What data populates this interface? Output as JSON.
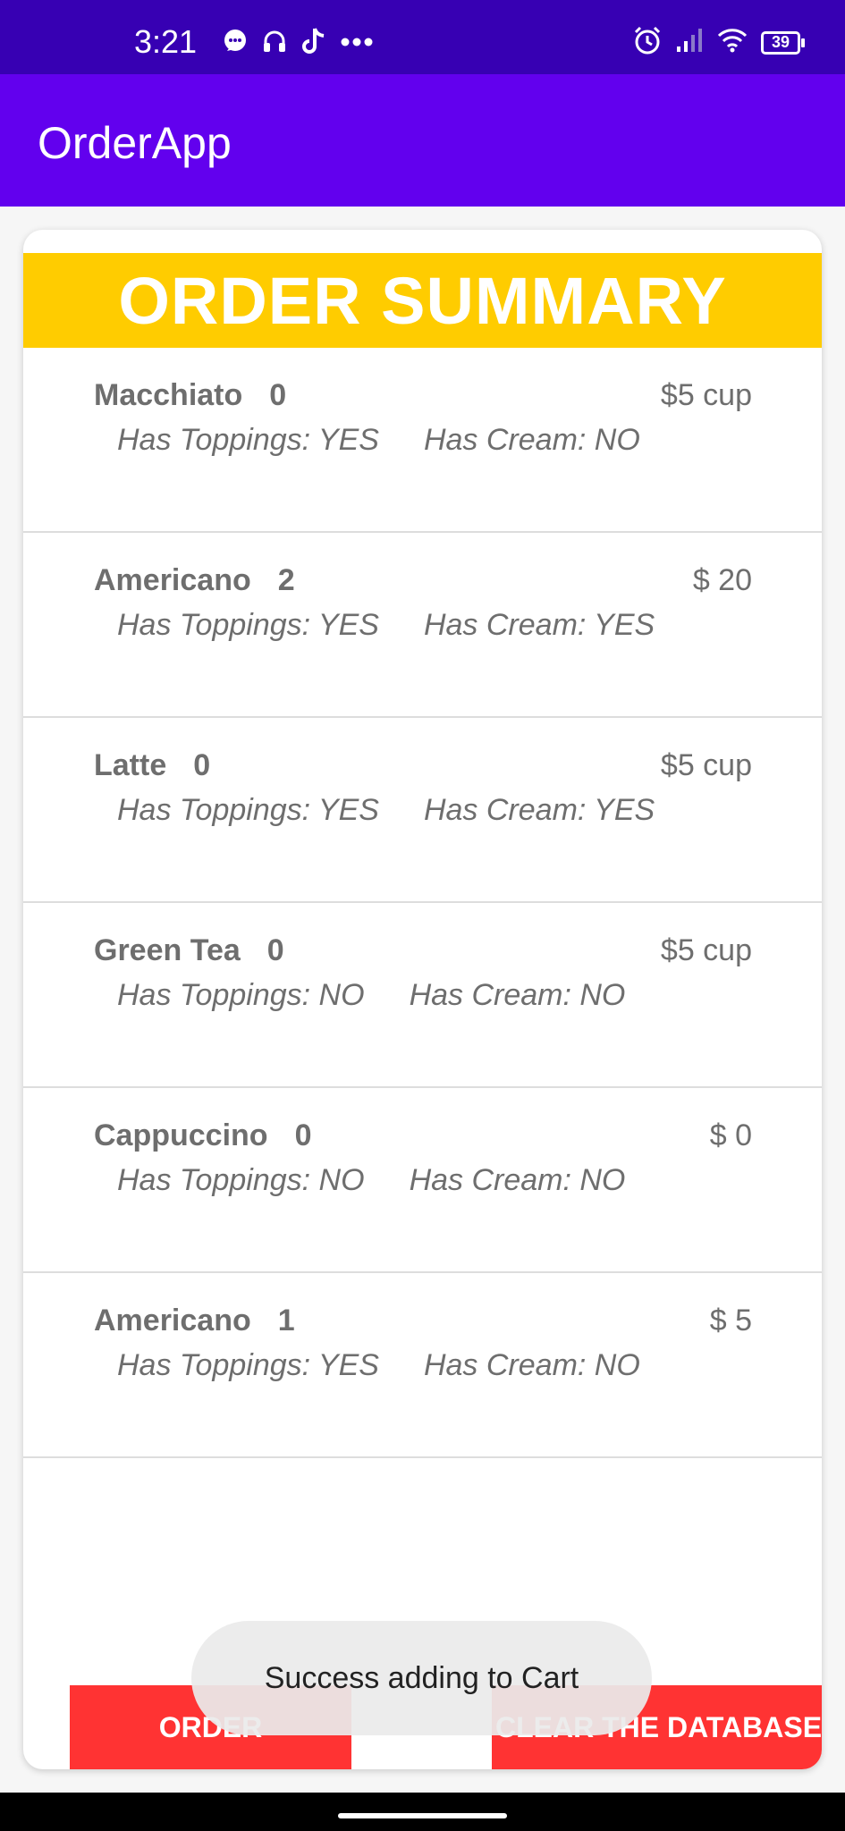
{
  "status_bar": {
    "time": "3:21",
    "battery": "39",
    "left_icons": [
      "chat-icon",
      "headset-icon",
      "tiktok-icon",
      "more-icon"
    ],
    "right_icons": [
      "alarm-icon",
      "signal-icon",
      "wifi-icon",
      "battery-icon"
    ]
  },
  "app_bar": {
    "title": "OrderApp"
  },
  "summary": {
    "title": "ORDER SUMMARY"
  },
  "orders": [
    {
      "name": "Macchiato",
      "qty": "0",
      "price": "$5 cup",
      "toppings": "Has Toppings: YES",
      "cream": "Has Cream: NO"
    },
    {
      "name": "Americano",
      "qty": "2",
      "price": "$ 20",
      "toppings": "Has Toppings: YES",
      "cream": "Has Cream: YES"
    },
    {
      "name": "Latte",
      "qty": "0",
      "price": "$5 cup",
      "toppings": "Has Toppings: YES",
      "cream": "Has Cream: YES"
    },
    {
      "name": "Green Tea",
      "qty": "0",
      "price": "$5 cup",
      "toppings": "Has Toppings: NO",
      "cream": "Has Cream: NO"
    },
    {
      "name": "Cappuccino",
      "qty": "0",
      "price": "$ 0",
      "toppings": "Has Toppings: NO",
      "cream": "Has Cream: NO"
    },
    {
      "name": "Americano",
      "qty": "1",
      "price": "$ 5",
      "toppings": "Has Toppings: YES",
      "cream": "Has Cream: NO"
    }
  ],
  "buttons": {
    "order": "ORDER",
    "clear": "CLEAR THE DATABASE"
  },
  "toast": {
    "message": "Success  adding to Cart"
  },
  "colors": {
    "status_bar": "#3700b3",
    "app_bar": "#6200ee",
    "header": "#ffcc00",
    "button": "#ff3333"
  }
}
